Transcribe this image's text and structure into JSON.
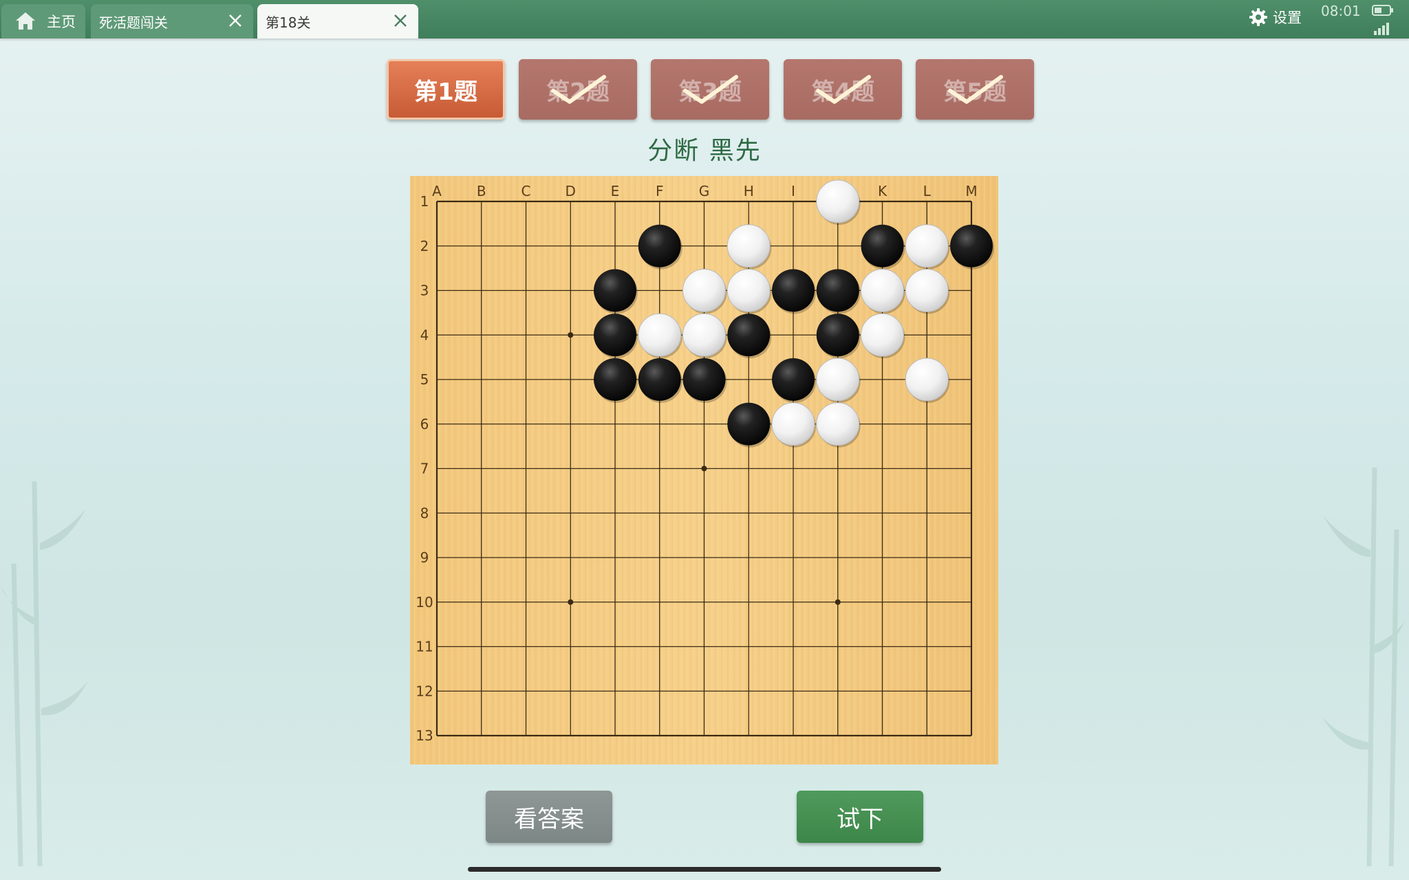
{
  "tabs": {
    "home": {
      "label": "主页",
      "icon": "home-icon"
    },
    "levels": {
      "label": "死活题闯关",
      "close_icon": "close-icon"
    },
    "current": {
      "label": "第18关",
      "close_icon": "close-icon"
    }
  },
  "status": {
    "settings_label": "设置",
    "time": "08:01"
  },
  "problems": [
    {
      "label": "第1题",
      "active": true,
      "solved": false
    },
    {
      "label": "第2题",
      "active": false,
      "solved": true
    },
    {
      "label": "第3题",
      "active": false,
      "solved": true
    },
    {
      "label": "第4题",
      "active": false,
      "solved": true
    },
    {
      "label": "第5题",
      "active": false,
      "solved": true
    }
  ],
  "subtitle": "分断  黑先",
  "board": {
    "size": 13,
    "columns": [
      "A",
      "B",
      "C",
      "D",
      "E",
      "F",
      "G",
      "H",
      "I",
      "J",
      "K",
      "L",
      "M"
    ],
    "rows": [
      "1",
      "2",
      "3",
      "4",
      "5",
      "6",
      "7",
      "8",
      "9",
      "10",
      "11",
      "12",
      "13"
    ],
    "star_points": [
      "D4",
      "G7",
      "D10",
      "J10"
    ],
    "black_stones": [
      "F2",
      "K2",
      "M2",
      "E3",
      "I3",
      "J3",
      "E4",
      "H4",
      "J4",
      "E5",
      "F5",
      "G5",
      "I5",
      "H6"
    ],
    "white_stones": [
      "J1",
      "H2",
      "L2",
      "G3",
      "H3",
      "K3",
      "L3",
      "F4",
      "G4",
      "K4",
      "J5",
      "L5",
      "I6",
      "J6"
    ]
  },
  "buttons": {
    "answer": "看答案",
    "try": "试下"
  }
}
